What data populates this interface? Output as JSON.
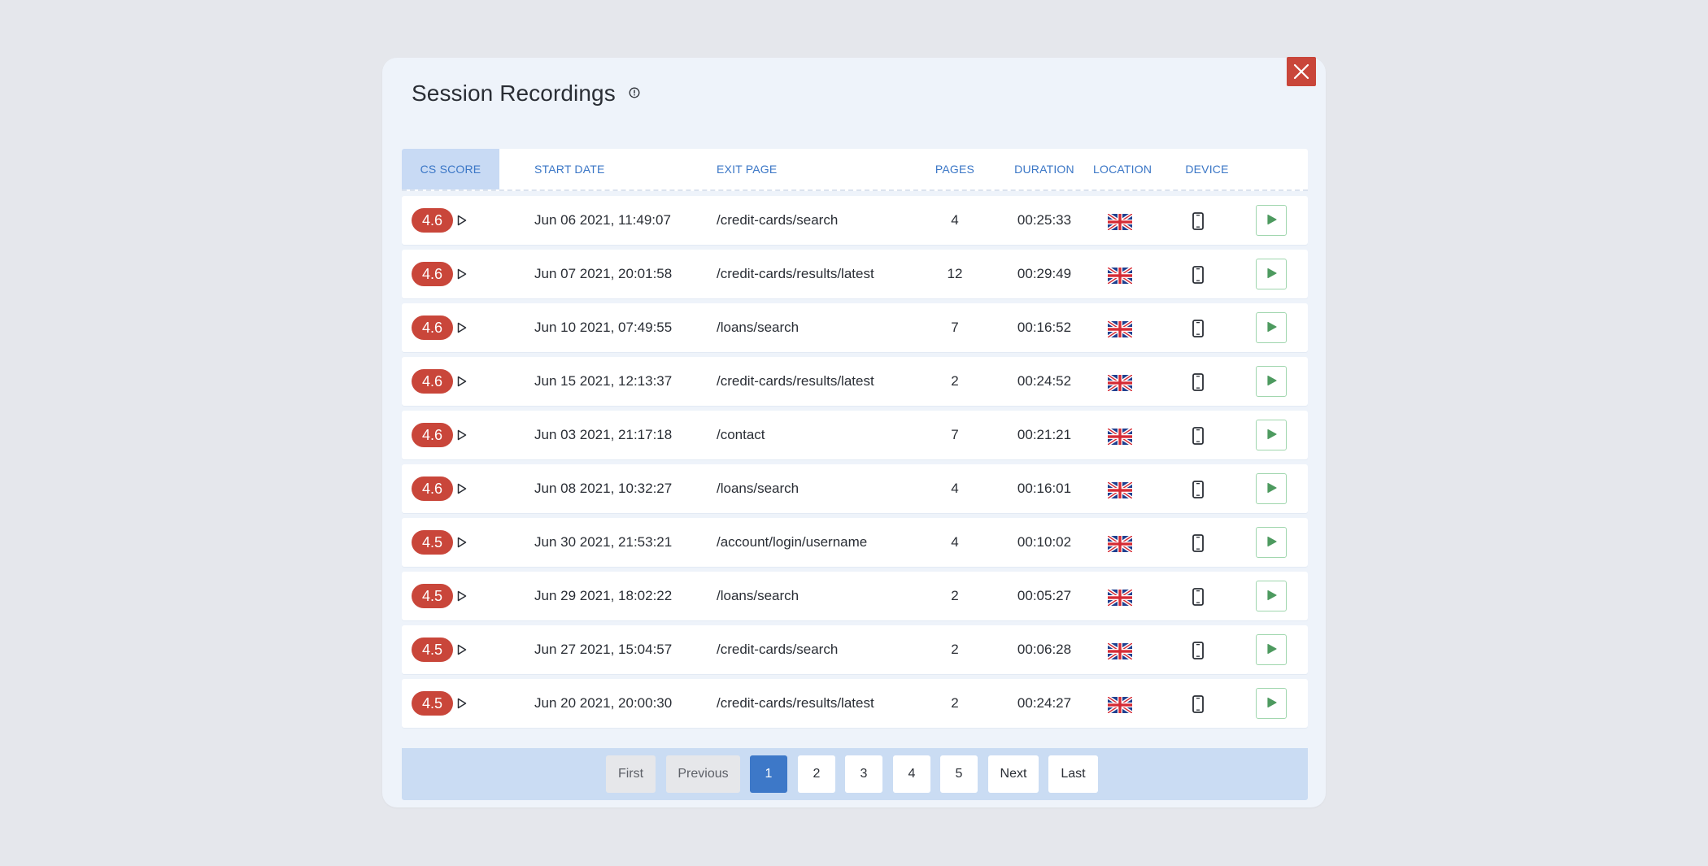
{
  "modal": {
    "title": "Session Recordings"
  },
  "table": {
    "headers": {
      "cs_score": "CS SCORE",
      "start_date": "START DATE",
      "exit_page": "EXIT PAGE",
      "pages": "PAGES",
      "duration": "DURATION",
      "location": "LOCATION",
      "device": "DEVICE"
    },
    "rows": [
      {
        "score": "4.6",
        "start_date": "Jun 06 2021, 11:49:07",
        "exit_page": "/credit-cards/search",
        "pages": "4",
        "duration": "00:25:33",
        "location_icon": "uk-flag-icon",
        "device_icon": "mobile-phone-icon"
      },
      {
        "score": "4.6",
        "start_date": "Jun 07 2021, 20:01:58",
        "exit_page": "/credit-cards/results/latest",
        "pages": "12",
        "duration": "00:29:49",
        "location_icon": "uk-flag-icon",
        "device_icon": "mobile-phone-icon"
      },
      {
        "score": "4.6",
        "start_date": "Jun 10 2021, 07:49:55",
        "exit_page": "/loans/search",
        "pages": "7",
        "duration": "00:16:52",
        "location_icon": "uk-flag-icon",
        "device_icon": "mobile-phone-icon"
      },
      {
        "score": "4.6",
        "start_date": "Jun 15 2021, 12:13:37",
        "exit_page": "/credit-cards/results/latest",
        "pages": "2",
        "duration": "00:24:52",
        "location_icon": "uk-flag-icon",
        "device_icon": "mobile-phone-icon"
      },
      {
        "score": "4.6",
        "start_date": "Jun 03 2021, 21:17:18",
        "exit_page": "/contact",
        "pages": "7",
        "duration": "00:21:21",
        "location_icon": "uk-flag-icon",
        "device_icon": "mobile-phone-icon"
      },
      {
        "score": "4.6",
        "start_date": "Jun 08 2021, 10:32:27",
        "exit_page": "/loans/search",
        "pages": "4",
        "duration": "00:16:01",
        "location_icon": "uk-flag-icon",
        "device_icon": "mobile-phone-icon"
      },
      {
        "score": "4.5",
        "start_date": "Jun 30 2021, 21:53:21",
        "exit_page": "/account/login/username",
        "pages": "4",
        "duration": "00:10:02",
        "location_icon": "uk-flag-icon",
        "device_icon": "mobile-phone-icon"
      },
      {
        "score": "4.5",
        "start_date": "Jun 29 2021, 18:02:22",
        "exit_page": "/loans/search",
        "pages": "2",
        "duration": "00:05:27",
        "location_icon": "uk-flag-icon",
        "device_icon": "mobile-phone-icon"
      },
      {
        "score": "4.5",
        "start_date": "Jun 27 2021, 15:04:57",
        "exit_page": "/credit-cards/search",
        "pages": "2",
        "duration": "00:06:28",
        "location_icon": "uk-flag-icon",
        "device_icon": "mobile-phone-icon"
      },
      {
        "score": "4.5",
        "start_date": "Jun 20 2021, 20:00:30",
        "exit_page": "/credit-cards/results/latest",
        "pages": "2",
        "duration": "00:24:27",
        "location_icon": "uk-flag-icon",
        "device_icon": "mobile-phone-icon"
      }
    ]
  },
  "pagination": {
    "first": "First",
    "previous": "Previous",
    "pages": [
      "1",
      "2",
      "3",
      "4",
      "5"
    ],
    "current": "1",
    "next": "Next",
    "last": "Last"
  },
  "colors": {
    "accent": "#3d78c8",
    "score_badge": "#c9463a",
    "close_button": "#c9463a",
    "play_border": "#9fd6ad",
    "play_icon": "#4d9a5f"
  }
}
